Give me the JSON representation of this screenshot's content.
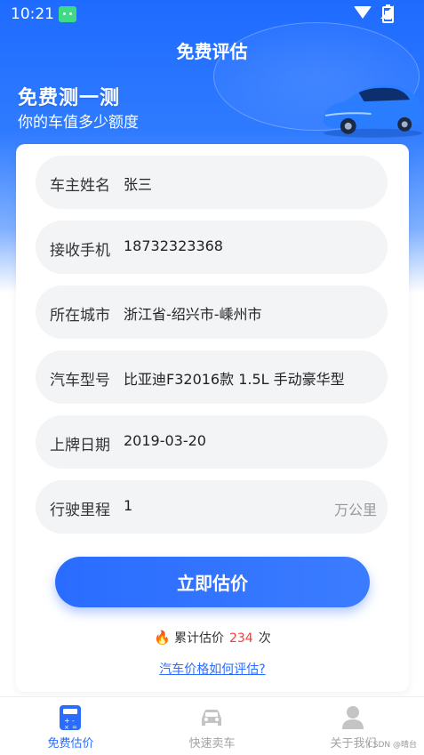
{
  "status_bar": {
    "time": "10:21"
  },
  "header": {
    "title": "免费评估"
  },
  "hero": {
    "title": "免费测一测",
    "subtitle": "你的车值多少额度"
  },
  "form": {
    "rows": [
      {
        "label": "车主姓名",
        "value": "张三"
      },
      {
        "label": "接收手机",
        "value": "18732323368"
      },
      {
        "label": "所在城市",
        "value": "浙江省-绍兴市-嵊州市"
      },
      {
        "label": "汽车型号",
        "value": "比亚迪F32016款 1.5L 手动豪华型"
      },
      {
        "label": "上牌日期",
        "value": "2019-03-20"
      },
      {
        "label": "行驶里程",
        "value": "1",
        "unit": "万公里"
      }
    ]
  },
  "action": {
    "button_label": "立即估价"
  },
  "stats": {
    "prefix": "累计估价",
    "count": "234",
    "suffix": "次"
  },
  "help": {
    "link": "汽车价格如何评估?"
  },
  "tabs": [
    {
      "label": "免费估价",
      "icon": "calculator-icon"
    },
    {
      "label": "快速卖车",
      "icon": "car-icon"
    },
    {
      "label": "关于我们",
      "icon": "user-icon"
    }
  ],
  "watermark": "CSDN @晴台",
  "colors": {
    "primary": "#2a6cff",
    "highlight": "#ff3b30"
  }
}
